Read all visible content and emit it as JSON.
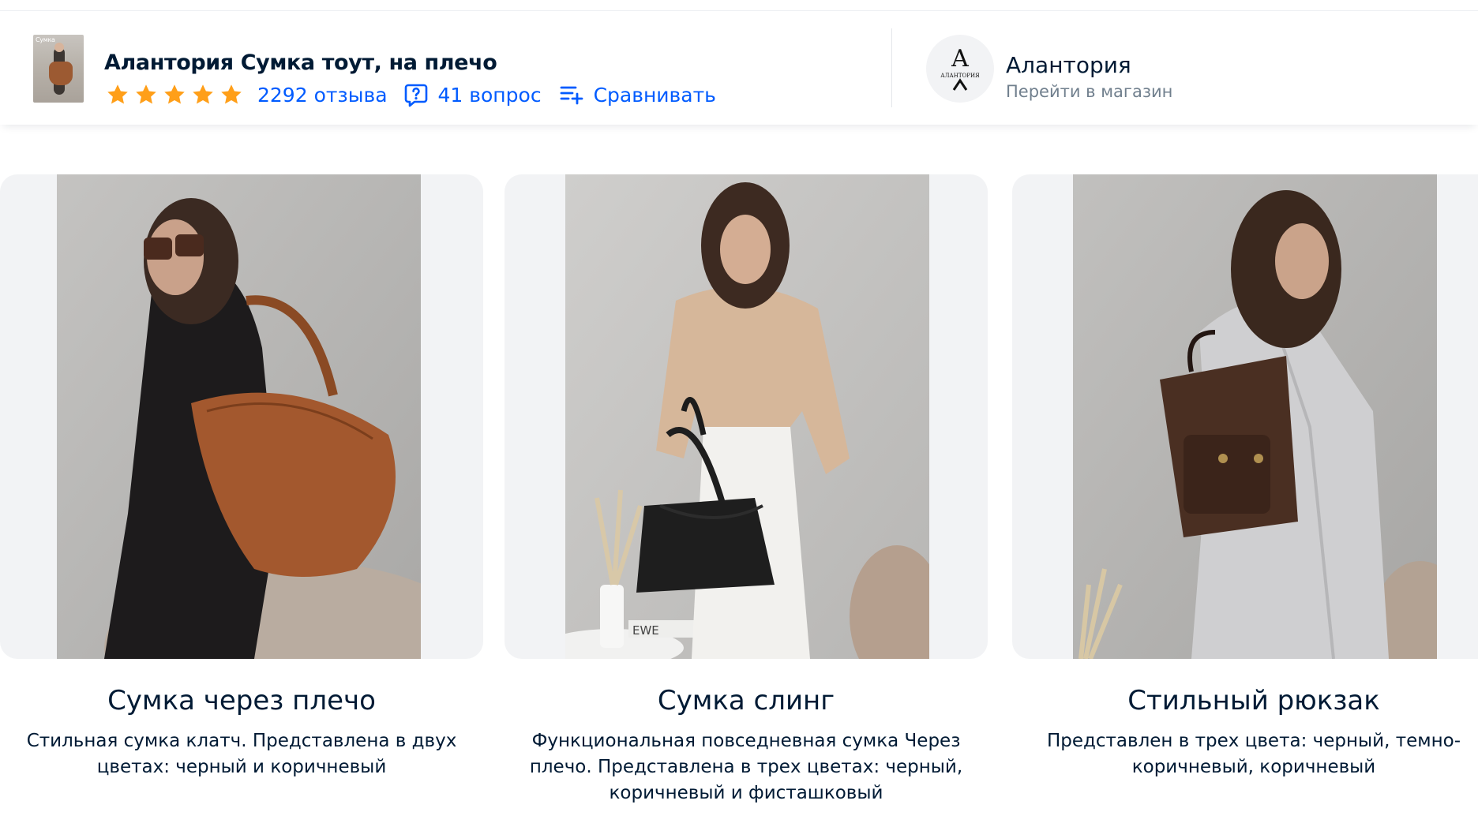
{
  "header": {
    "thumbnail_caption": "Сумка",
    "product_title": "Алантория Сумка тоут, на плечо",
    "rating_stars": 5,
    "star_color": "#ff9f19",
    "reviews_label": "2292 отзыва",
    "questions_label": "41 вопрос",
    "compare_label": "Сравнивать",
    "link_color": "#005bff"
  },
  "store": {
    "logo_letter": "A",
    "logo_text": "АЛАНТОРИЯ",
    "name": "Алантория",
    "go_to_store": "Перейти в магазин"
  },
  "cards": [
    {
      "title": "Сумка через плечо",
      "description": "Стильная сумка клатч. Представлена в двух цветах: черный и коричневый",
      "image_icon": "model-with-brown-shoulder-bag"
    },
    {
      "title": "Сумка слинг",
      "description": "Функциональная повседневная сумка Через плечо. Представлена в трех цветах: черный, коричневый и фисташковый",
      "image_icon": "model-with-black-tote-bag",
      "magazine_text": "EWE"
    },
    {
      "title": "Стильный рюкзак",
      "description": "Представлен в трех цвета: черный, темно-коричневый, коричневый",
      "image_icon": "model-with-brown-backpack"
    }
  ]
}
